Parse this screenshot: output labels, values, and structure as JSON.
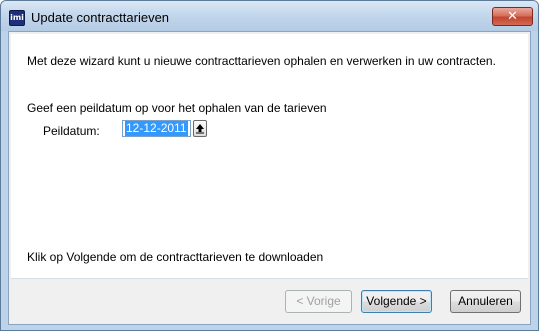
{
  "window": {
    "title": "Update contracttarieven",
    "app_icon_text": "imi",
    "close_glyph": "✕"
  },
  "wizard": {
    "intro": "Met deze wizard kunt u nieuwe contracttarieven ophalen en verwerken in uw contracten.",
    "instruction": "Geef een peildatum op voor het ophalen van de tarieven",
    "peildatum_label": "Peildatum:",
    "peildatum_value": "12-12-2011",
    "footer": "Klik op Volgende om de contracttarieven te downloaden"
  },
  "buttons": {
    "previous": "< Vorige",
    "next": "Volgende >",
    "cancel": "Annuleren"
  },
  "colors": {
    "selection": "#3399ff",
    "title_bar": "#c3d7ec",
    "close_button": "#c2452f"
  },
  "icons": {
    "spin": "up-arrow-icon",
    "close": "close-icon",
    "app": "app-icon"
  }
}
